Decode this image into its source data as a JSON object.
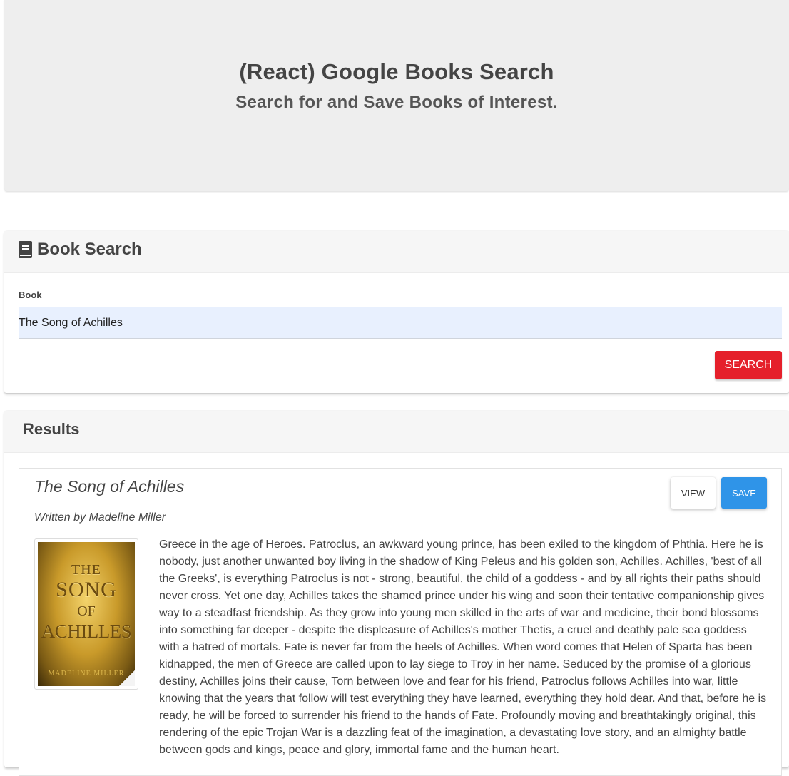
{
  "header": {
    "title": "(React) Google Books Search",
    "subtitle": "Search for and Save Books of Interest."
  },
  "search": {
    "heading": "Book Search",
    "icon": "book-icon",
    "label": "Book",
    "value": "The Song of Achilles",
    "button_label": "SEARCH",
    "button_color": "#e5202b"
  },
  "results": {
    "heading": "Results",
    "items": [
      {
        "title": "The Song of Achilles",
        "author": "Written by Madeline Miller",
        "view_label": "VIEW",
        "save_label": "SAVE",
        "save_color": "#2f94e8",
        "cover": {
          "line1": "THE",
          "line2": "SONG",
          "line3": "OF",
          "line4": "ACHILLES",
          "author_text": "MADELINE MILLER"
        },
        "description": "Greece in the age of Heroes. Patroclus, an awkward young prince, has been exiled to the kingdom of Phthia. Here he is nobody, just another unwanted boy living in the shadow of King Peleus and his golden son, Achilles. Achilles, 'best of all the Greeks', is everything Patroclus is not - strong, beautiful, the child of a goddess - and by all rights their paths should never cross. Yet one day, Achilles takes the shamed prince under his wing and soon their tentative companionship gives way to a steadfast friendship. As they grow into young men skilled in the arts of war and medicine, their bond blossoms into something far deeper - despite the displeasure of Achilles's mother Thetis, a cruel and deathly pale sea goddess with a hatred of mortals. Fate is never far from the heels of Achilles. When word comes that Helen of Sparta has been kidnapped, the men of Greece are called upon to lay siege to Troy in her name. Seduced by the promise of a glorious destiny, Achilles joins their cause, Torn between love and fear for his friend, Patroclus follows Achilles into war, little knowing that the years that follow will test everything they have learned, everything they hold dear. And that, before he is ready, he will be forced to surrender his friend to the hands of Fate. Profoundly moving and breathtakingly original, this rendering of the epic Trojan War is a dazzling feat of the imagination, a devastating love story, and an almighty battle between gods and kings, peace and glory, immortal fame and the human heart."
      }
    ]
  }
}
